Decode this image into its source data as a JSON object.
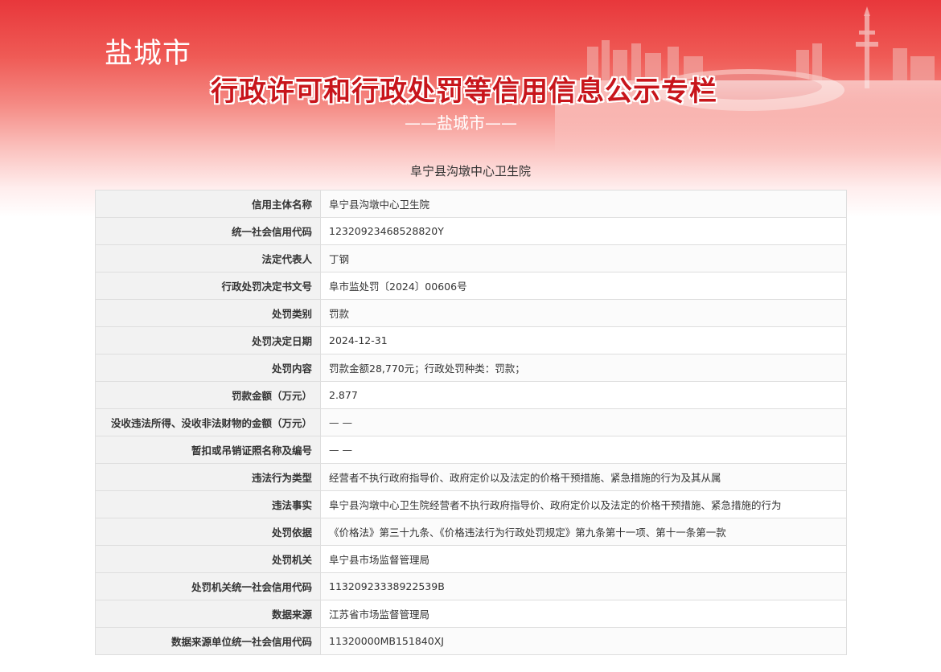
{
  "header": {
    "city": "盐城市",
    "title": "行政许可和行政处罚等信用信息公示专栏",
    "subtitle": "——盐城市——"
  },
  "entity_heading": "阜宁县沟墩中心卫生院",
  "rows": [
    {
      "label": "信用主体名称",
      "value": "阜宁县沟墩中心卫生院"
    },
    {
      "label": "统一社会信用代码",
      "value": "12320923468528820Y"
    },
    {
      "label": "法定代表人",
      "value": "丁钢"
    },
    {
      "label": "行政处罚决定书文号",
      "value": "阜市监处罚〔2024〕00606号"
    },
    {
      "label": "处罚类别",
      "value": "罚款"
    },
    {
      "label": "处罚决定日期",
      "value": "2024-12-31"
    },
    {
      "label": "处罚内容",
      "value": "罚款金额28,770元；行政处罚种类：罚款；"
    },
    {
      "label": "罚款金额（万元）",
      "value": "2.877"
    },
    {
      "label": "没收违法所得、没收非法财物的金额（万元）",
      "value": "— —"
    },
    {
      "label": "暂扣或吊销证照名称及编号",
      "value": "— —"
    },
    {
      "label": "违法行为类型",
      "value": "经营者不执行政府指导价、政府定价以及法定的价格干预措施、紧急措施的行为及其从属"
    },
    {
      "label": "违法事实",
      "value": "阜宁县沟墩中心卫生院经营者不执行政府指导价、政府定价以及法定的价格干预措施、紧急措施的行为"
    },
    {
      "label": "处罚依据",
      "value": "《价格法》第三十九条、《价格违法行为行政处罚规定》第九条第十一项、第十一条第一款"
    },
    {
      "label": "处罚机关",
      "value": "阜宁县市场监督管理局"
    },
    {
      "label": "处罚机关统一社会信用代码",
      "value": "11320923338922539B"
    },
    {
      "label": "数据来源",
      "value": "江苏省市场监督管理局"
    },
    {
      "label": "数据来源单位统一社会信用代码",
      "value": "11320000MB151840XJ"
    }
  ]
}
